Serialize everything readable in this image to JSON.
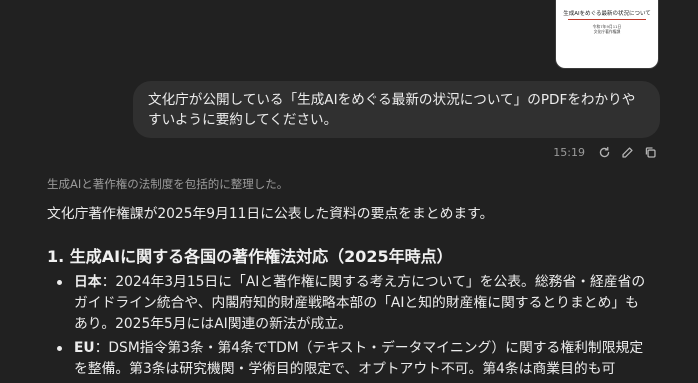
{
  "attachment": {
    "title": "生成AIをめぐる最新の状況について",
    "date": "令和7年9月11日",
    "org": "文化庁著作権課"
  },
  "user_message": {
    "text": "文化庁が公開している「生成AIをめぐる最新の状況について」のPDFをわかりやすいように要約してください。",
    "time": "15:19",
    "actions": [
      "retry-icon",
      "edit-icon",
      "copy-icon"
    ]
  },
  "assistant": {
    "thought": "生成AIと著作権の法制度を包括的に整理した。",
    "intro": "文化庁著作権課が2025年9月11日に公表した資料の要点をまとめます。",
    "heading": "1. 生成AIに関する各国の著作権法対応（2025年時点）",
    "bullets": [
      {
        "label": "日本",
        "text": "：2024年3月15日に「AIと著作権に関する考え方について」を公表。総務省・経産省のガイドライン統合や、内閣府知的財産戦略本部の「AIと知的財産権に関するとりまとめ」もあり。2025年5月にはAI関連の新法が成立。"
      },
      {
        "label": "EU",
        "text": "：DSM指令第3条・第4条でTDM（テキスト・データマイニング）に関する権利制限規定を整備。第3条は研究機関・学術目的限定で、オプトアウト不可。第4条は商業目的も可"
      }
    ]
  }
}
